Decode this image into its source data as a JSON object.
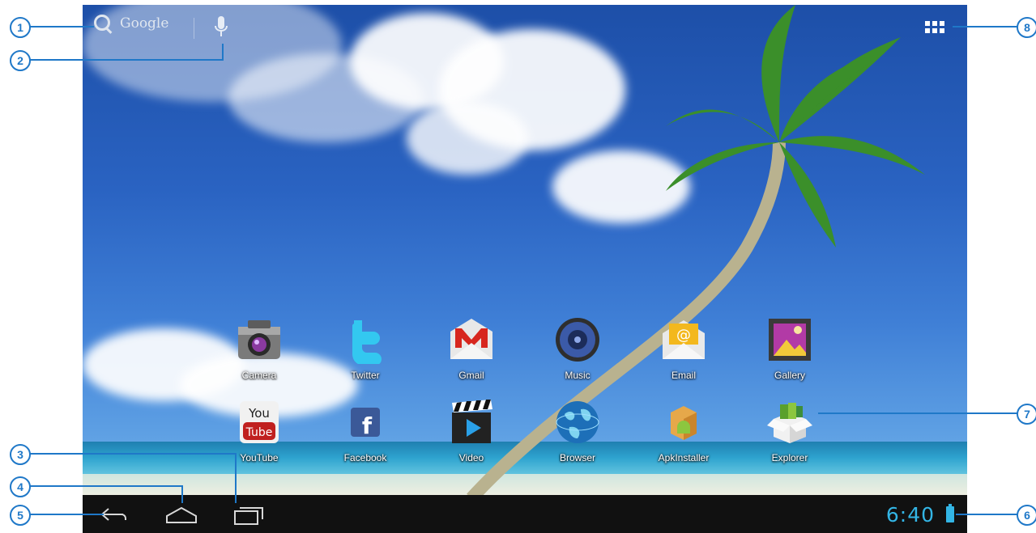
{
  "search": {
    "label": "Google"
  },
  "apps": [
    {
      "label": "Camera"
    },
    {
      "label": "Twitter"
    },
    {
      "label": "Gmail"
    },
    {
      "label": "Music"
    },
    {
      "label": "Email"
    },
    {
      "label": "Gallery"
    },
    {
      "label": "YouTube"
    },
    {
      "label": "Facebook"
    },
    {
      "label": "Video"
    },
    {
      "label": "Browser"
    },
    {
      "label": "ApkInstaller"
    },
    {
      "label": "Explorer"
    }
  ],
  "status": {
    "time": "6:40"
  },
  "callouts": [
    "1",
    "2",
    "3",
    "4",
    "5",
    "6",
    "7",
    "8"
  ],
  "colors": {
    "accent": "#33b5e5",
    "callout": "#1f78c8",
    "navbar": "#111111"
  },
  "icons": {
    "youtube_top": "You",
    "youtube_bottom": "Tube",
    "facebook": "f",
    "email": "@"
  }
}
